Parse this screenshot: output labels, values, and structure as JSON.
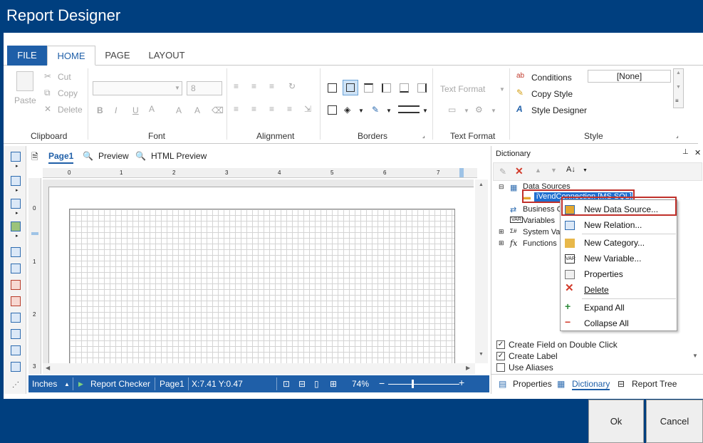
{
  "window": {
    "title": "Report Designer"
  },
  "ribbon_tabs": [
    "FILE",
    "HOME",
    "PAGE",
    "LAYOUT"
  ],
  "clipboard": {
    "paste": "Paste",
    "cut": "Cut",
    "copy": "Copy",
    "delete": "Delete",
    "group": "Clipboard"
  },
  "font": {
    "size": "8",
    "group": "Font",
    "bold": "B",
    "italic": "I",
    "underline": "U",
    "color": "A"
  },
  "alignment": {
    "group": "Alignment"
  },
  "borders": {
    "group": "Borders"
  },
  "text_format": {
    "label": "Text Format",
    "group": "Text Format"
  },
  "style": {
    "conditions": "Conditions",
    "copy_style": "Copy Style",
    "style_designer": "Style Designer",
    "current": "[None]",
    "group": "Style"
  },
  "page_tabs": {
    "page": "Page1",
    "preview": "Preview",
    "html_preview": "HTML Preview"
  },
  "ruler_h": [
    "0",
    "1",
    "2",
    "3",
    "4",
    "5",
    "6",
    "7"
  ],
  "ruler_v": [
    "0",
    "1",
    "2",
    "3"
  ],
  "status": {
    "units": "Inches",
    "checker": "Report Checker",
    "page": "Page1",
    "coords": "X:7.41  Y:0.47",
    "zoom": "74%"
  },
  "dictionary": {
    "title": "Dictionary",
    "tree": {
      "data_sources": "Data Sources",
      "connection": "iVendConnection [MS SQL]",
      "business": "Business O",
      "variables": "Variables",
      "system": "System Va",
      "functions": "Functions"
    },
    "context_menu": [
      "New Data Source...",
      "New Relation...",
      "New Category...",
      "New Variable...",
      "Properties",
      "Delete",
      "Expand All",
      "Collapse All"
    ],
    "options": [
      {
        "label": "Create Field on Double Click",
        "checked": true
      },
      {
        "label": "Create Label",
        "checked": true
      },
      {
        "label": "Use Aliases",
        "checked": false
      }
    ],
    "bottom_tabs": [
      "Properties",
      "Dictionary",
      "Report Tree"
    ]
  },
  "buttons": {
    "ok": "Ok",
    "cancel": "Cancel"
  }
}
